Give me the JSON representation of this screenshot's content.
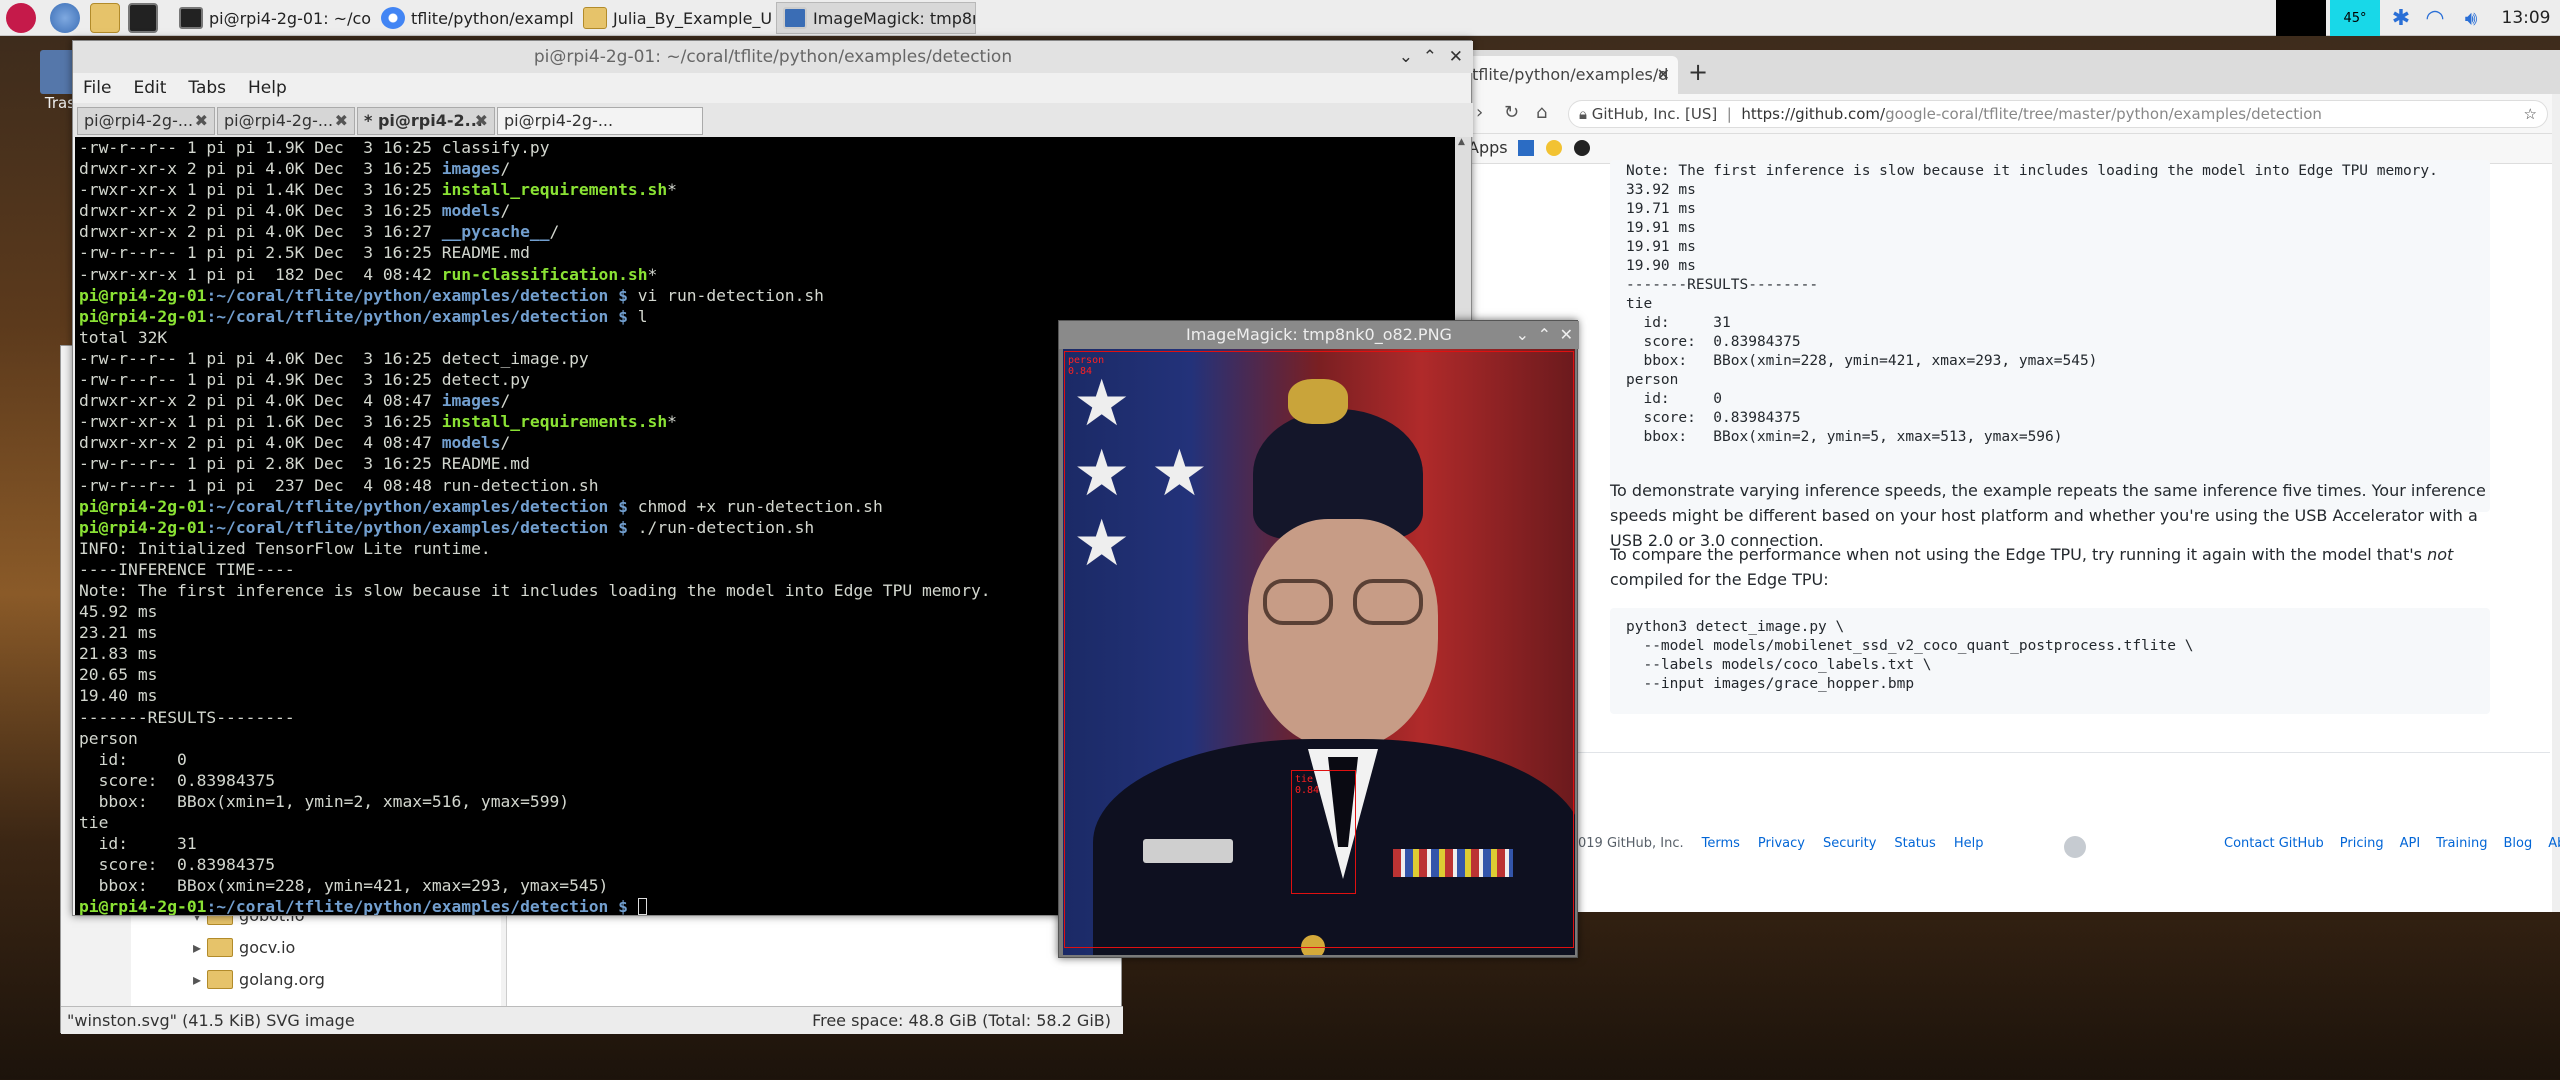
{
  "taskbar": {
    "tasks": [
      {
        "label": "pi@rpi4-2g-01: ~/cor...",
        "icon": "terminal-icon"
      },
      {
        "label": "tflite/python/example...",
        "icon": "chromium-icon"
      },
      {
        "label": "Julia_By_Example_U...",
        "icon": "folder-icon"
      },
      {
        "label": "ImageMagick: tmp8n...",
        "icon": "imagemagick-icon"
      }
    ],
    "cpu": "45°",
    "time": "13:09"
  },
  "desktop": {
    "trash_label": "Tras"
  },
  "filemanager": {
    "tree": [
      "gobot.io",
      "gocv.io",
      "golang.org"
    ],
    "status_left": "\"winston.svg\" (41.5 KiB) SVG image",
    "status_right": "Free space: 48.8 GiB (Total: 58.2 GiB)"
  },
  "browser": {
    "tab": "tflite/python/examples/d",
    "site": "GitHub, Inc. [US]",
    "url_prefix": "https://github.com/",
    "url_path": "google-coral/tflite/tree/master/python/examples/detection",
    "bookmarks_apps": "Apps",
    "output_block": "Note: The first inference is slow because it includes loading the model into Edge TPU memory.\n33.92 ms\n19.71 ms\n19.91 ms\n19.91 ms\n19.90 ms\n-------RESULTS--------\ntie\n  id:     31\n  score:  0.83984375\n  bbox:   BBox(xmin=228, ymin=421, xmax=293, ymax=545)\nperson\n  id:     0\n  score:  0.83984375\n  bbox:   BBox(xmin=2, ymin=5, xmax=513, ymax=596)",
    "para1": "To demonstrate varying inference speeds, the example repeats the same inference five times. Your inference speeds might be different based on your host platform and whether you're using the USB Accelerator with a USB 2.0 or 3.0 connection.",
    "para2_a": "To compare the performance when not using the Edge TPU, try running it again with the model that's ",
    "para2_em": "not",
    "para2_b": " compiled for the Edge TPU:",
    "code_block": "python3 detect_image.py \\\n  --model models/mobilenet_ssd_v2_coco_quant_postprocess.tflite \\\n  --labels models/coco_labels.txt \\\n  --input images/grace_hopper.bmp",
    "footer_copy": "019 GitHub, Inc.",
    "footer_links_left": [
      "Terms",
      "Privacy",
      "Security",
      "Status",
      "Help"
    ],
    "footer_links_right": [
      "Contact GitHub",
      "Pricing",
      "API",
      "Training",
      "Blog",
      "About"
    ]
  },
  "terminal": {
    "title": "pi@rpi4-2g-01: ~/coral/tflite/python/examples/detection",
    "menu": [
      "File",
      "Edit",
      "Tabs",
      "Help"
    ],
    "tabs": [
      "pi@rpi4-2g-...",
      "pi@rpi4-2g-...",
      "* pi@rpi4-2...",
      "pi@rpi4-2g-..."
    ],
    "prompt_user": "pi@rpi4-2g-01",
    "prompt_path": ":~/coral/tflite/python/examples/detection $ ",
    "lines": [
      {
        "t": "file",
        "p": "-rw-r--r-- 1 pi pi 1.9K Dec  3 16:25 ",
        "n": "classify.py",
        "c": ""
      },
      {
        "t": "file",
        "p": "drwxr-xr-x 2 pi pi 4.0K Dec  3 16:25 ",
        "n": "images",
        "c": "b",
        "s": "/"
      },
      {
        "t": "file",
        "p": "-rwxr-xr-x 1 pi pi 1.4K Dec  3 16:25 ",
        "n": "install_requirements.sh",
        "c": "g",
        "s": "*"
      },
      {
        "t": "file",
        "p": "drwxr-xr-x 2 pi pi 4.0K Dec  3 16:25 ",
        "n": "models",
        "c": "b",
        "s": "/"
      },
      {
        "t": "file",
        "p": "drwxr-xr-x 2 pi pi 4.0K Dec  3 16:27 ",
        "n": "__pycache__",
        "c": "b",
        "s": "/"
      },
      {
        "t": "file",
        "p": "-rw-r--r-- 1 pi pi 2.5K Dec  3 16:25 ",
        "n": "README.md",
        "c": ""
      },
      {
        "t": "file",
        "p": "-rwxr-xr-x 1 pi pi  182 Dec  4 08:42 ",
        "n": "run-classification.sh",
        "c": "g",
        "s": "*"
      },
      {
        "t": "cmd",
        "v": "vi run-detection.sh"
      },
      {
        "t": "cmd",
        "v": "l"
      },
      {
        "t": "text",
        "v": "total 32K"
      },
      {
        "t": "file",
        "p": "-rw-r--r-- 1 pi pi 4.0K Dec  3 16:25 ",
        "n": "detect_image.py",
        "c": ""
      },
      {
        "t": "file",
        "p": "-rw-r--r-- 1 pi pi 4.9K Dec  3 16:25 ",
        "n": "detect.py",
        "c": ""
      },
      {
        "t": "file",
        "p": "drwxr-xr-x 2 pi pi 4.0K Dec  4 08:47 ",
        "n": "images",
        "c": "b",
        "s": "/"
      },
      {
        "t": "file",
        "p": "-rwxr-xr-x 1 pi pi 1.6K Dec  3 16:25 ",
        "n": "install_requirements.sh",
        "c": "g",
        "s": "*"
      },
      {
        "t": "file",
        "p": "drwxr-xr-x 2 pi pi 4.0K Dec  4 08:47 ",
        "n": "models",
        "c": "b",
        "s": "/"
      },
      {
        "t": "file",
        "p": "-rw-r--r-- 1 pi pi 2.8K Dec  3 16:25 ",
        "n": "README.md",
        "c": ""
      },
      {
        "t": "file",
        "p": "-rw-r--r-- 1 pi pi  237 Dec  4 08:48 ",
        "n": "run-detection.sh",
        "c": ""
      },
      {
        "t": "cmd",
        "v": "chmod +x run-detection.sh"
      },
      {
        "t": "cmd",
        "v": "./run-detection.sh"
      },
      {
        "t": "text",
        "v": "INFO: Initialized TensorFlow Lite runtime."
      },
      {
        "t": "text",
        "v": "----INFERENCE TIME----"
      },
      {
        "t": "text",
        "v": "Note: The first inference is slow because it includes loading the model into Edge TPU memory."
      },
      {
        "t": "text",
        "v": "45.92 ms"
      },
      {
        "t": "text",
        "v": "23.21 ms"
      },
      {
        "t": "text",
        "v": "21.83 ms"
      },
      {
        "t": "text",
        "v": "20.65 ms"
      },
      {
        "t": "text",
        "v": "19.40 ms"
      },
      {
        "t": "text",
        "v": "-------RESULTS--------"
      },
      {
        "t": "text",
        "v": "person"
      },
      {
        "t": "text",
        "v": "  id:     0"
      },
      {
        "t": "text",
        "v": "  score:  0.83984375"
      },
      {
        "t": "text",
        "v": "  bbox:   BBox(xmin=1, ymin=2, xmax=516, ymax=599)"
      },
      {
        "t": "text",
        "v": "tie"
      },
      {
        "t": "text",
        "v": "  id:     31"
      },
      {
        "t": "text",
        "v": "  score:  0.83984375"
      },
      {
        "t": "text",
        "v": "  bbox:   BBox(xmin=228, ymin=421, xmax=293, ymax=545)"
      },
      {
        "t": "cmd",
        "v": "",
        "cursor": true
      }
    ]
  },
  "imagemagick": {
    "title": "ImageMagick: tmp8nk0_o82.PNG",
    "detections": [
      {
        "label": "person",
        "score": "0.84"
      },
      {
        "label": "tie",
        "score": "0.84"
      }
    ]
  }
}
